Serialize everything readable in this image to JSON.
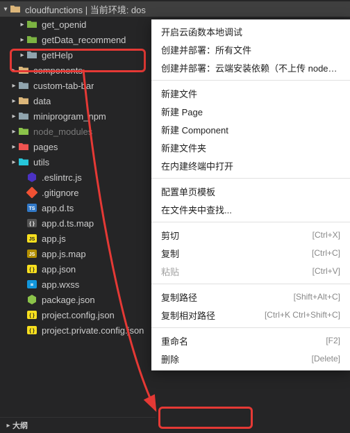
{
  "tree": {
    "root": {
      "label": "cloudfunctions | 当前环境: dos"
    },
    "rows": [
      {
        "chev": "r",
        "pad": 24,
        "icon": "folder-cloud",
        "label": "get_openid"
      },
      {
        "chev": "r",
        "pad": 24,
        "icon": "folder-cloud",
        "label": "getData_recommend"
      },
      {
        "chev": "r",
        "pad": 24,
        "icon": "folder-plain",
        "label": "getHelp"
      },
      {
        "chev": "r",
        "pad": 12,
        "icon": "folder-gold",
        "label": "components"
      },
      {
        "chev": "r",
        "pad": 12,
        "icon": "folder-plain",
        "label": "custom-tab-bar"
      },
      {
        "chev": "r",
        "pad": 12,
        "icon": "folder-gold",
        "label": "data"
      },
      {
        "chev": "r",
        "pad": 12,
        "icon": "folder-plain",
        "label": "miniprogram_npm"
      },
      {
        "chev": "r",
        "pad": 12,
        "icon": "folder-node",
        "label": "node_modules",
        "dim": true
      },
      {
        "chev": "r",
        "pad": 12,
        "icon": "folder-pages",
        "label": "pages"
      },
      {
        "chev": "r",
        "pad": 12,
        "icon": "folder-utils",
        "label": "utils"
      },
      {
        "chev": "",
        "pad": 24,
        "icon": "eslint",
        "label": ".eslintrc.js"
      },
      {
        "chev": "",
        "pad": 24,
        "icon": "git",
        "label": ".gitignore"
      },
      {
        "chev": "",
        "pad": 24,
        "icon": "ts",
        "label": "app.d.ts"
      },
      {
        "chev": "",
        "pad": 24,
        "icon": "map",
        "label": "app.d.ts.map"
      },
      {
        "chev": "",
        "pad": 24,
        "icon": "js",
        "label": "app.js"
      },
      {
        "chev": "",
        "pad": 24,
        "icon": "jsmap",
        "label": "app.js.map"
      },
      {
        "chev": "",
        "pad": 24,
        "icon": "json",
        "label": "app.json"
      },
      {
        "chev": "",
        "pad": 24,
        "icon": "wxss",
        "label": "app.wxss"
      },
      {
        "chev": "",
        "pad": 24,
        "icon": "npm",
        "label": "package.json"
      },
      {
        "chev": "",
        "pad": 24,
        "icon": "json",
        "label": "project.config.json"
      },
      {
        "chev": "",
        "pad": 24,
        "icon": "json",
        "label": "project.private.config.json"
      }
    ]
  },
  "footer": {
    "label": "大纲"
  },
  "menu": {
    "groups": [
      [
        {
          "label": "开启云函数本地调试"
        },
        {
          "label": "创建并部署：所有文件"
        },
        {
          "label": "创建并部署：云端安装依赖（不上传 node_modules）"
        }
      ],
      [
        {
          "label": "新建文件"
        },
        {
          "label": "新建 Page"
        },
        {
          "label": "新建 Component"
        },
        {
          "label": "新建文件夹"
        },
        {
          "label": "在内建终端中打开"
        }
      ],
      [
        {
          "label": "配置单页模板"
        },
        {
          "label": "在文件夹中查找..."
        }
      ],
      [
        {
          "label": "剪切",
          "key": "[Ctrl+X]"
        },
        {
          "label": "复制",
          "key": "[Ctrl+C]"
        },
        {
          "label": "粘贴",
          "key": "[Ctrl+V]",
          "disabled": true
        }
      ],
      [
        {
          "label": "复制路径",
          "key": "[Shift+Alt+C]"
        },
        {
          "label": "复制相对路径",
          "key": "[Ctrl+K Ctrl+Shift+C]"
        }
      ],
      [
        {
          "label": "重命名",
          "key": "[F2]"
        },
        {
          "label": "删除",
          "key": "[Delete]"
        }
      ]
    ]
  },
  "icons": {
    "folder-gold": {
      "fill": "#dcb67a"
    },
    "folder-cloud": {
      "fill": "#7cb342"
    },
    "folder-plain": {
      "fill": "#90a4ae"
    },
    "folder-node": {
      "fill": "#8bc34a"
    },
    "folder-pages": {
      "fill": "#ef5350"
    },
    "folder-utils": {
      "fill": "#26c6da"
    }
  }
}
